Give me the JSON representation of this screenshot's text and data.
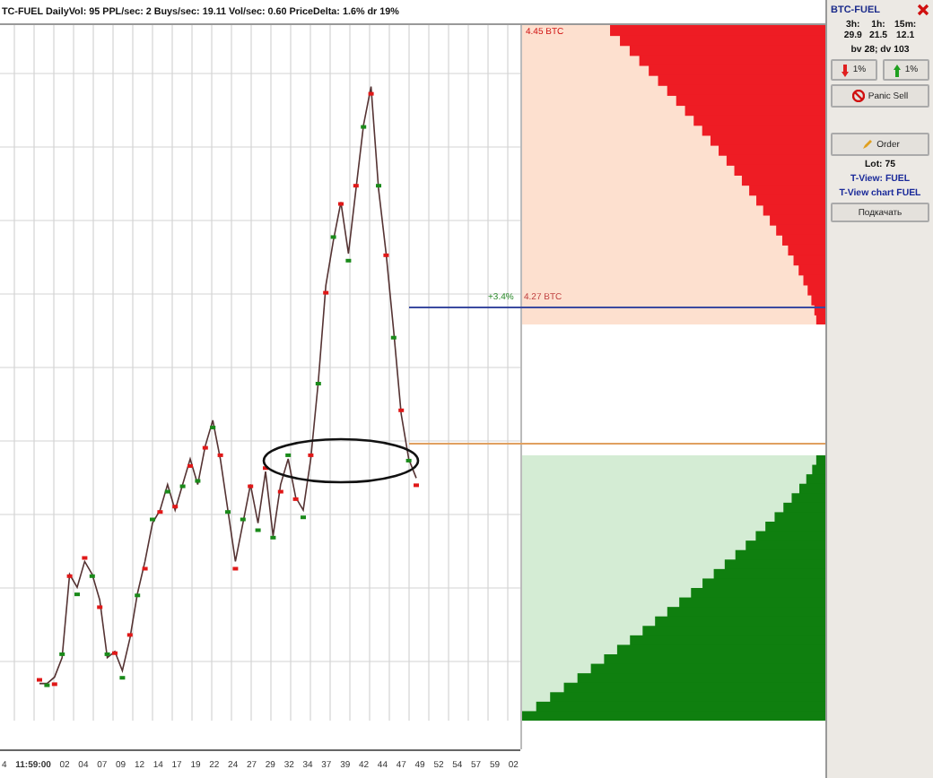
{
  "header": {
    "text": "TC-FUEL  DailyVol: 95 PPL/sec: 2  Buys/sec: 19.11 Vol/sec: 0.60 PriceDelta: 1.6%  dr 19%"
  },
  "book": {
    "top_price": "4.45 BTC",
    "delta": "+3.4%",
    "mid_price": "4.27 BTC"
  },
  "axis": {
    "labels": [
      "4",
      "11:59:00",
      "02",
      "04",
      "07",
      "09",
      "12",
      "14",
      "17",
      "19",
      "22",
      "24",
      "27",
      "29",
      "32",
      "34",
      "37",
      "39",
      "42",
      "44",
      "47",
      "49",
      "52",
      "54",
      "57",
      "59",
      "02"
    ]
  },
  "panel": {
    "title": "BTC-FUEL",
    "stats": [
      {
        "label": "3h:",
        "value": "29.9"
      },
      {
        "label": "1h:",
        "value": "21.5"
      },
      {
        "label": "15m:",
        "value": "12.1"
      }
    ],
    "summary": "bv 28; dv 103",
    "changes": [
      {
        "text": "1%",
        "kind": "down"
      },
      {
        "text": "1%",
        "kind": "up"
      }
    ],
    "panic_button": "Panic Sell",
    "order_button": "Order",
    "lot": "Lot: 75",
    "links": [
      "T-View: FUEL",
      "T-View chart FUEL"
    ],
    "extra_button": "Подкачать"
  }
}
